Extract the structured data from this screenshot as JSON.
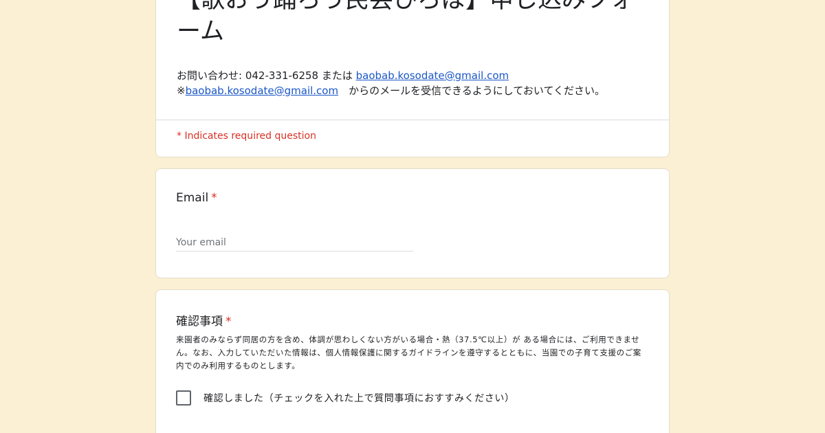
{
  "header": {
    "title": "【歌おう踊ろう民芸ひろば】申し込みフォーム",
    "contact_prefix": "お問い合わせ: 042-331-6258 または ",
    "contact_email": "baobab.kosodate@gmail.com",
    "notice_prefix": "※",
    "notice_email": "baobab.kosodate@gmail.com",
    "notice_suffix": "　からのメールを受信できるようにしておいてください。",
    "required_note": "* Indicates required question"
  },
  "email_question": {
    "label": "Email",
    "required_mark": "*",
    "placeholder": "Your email"
  },
  "confirm_question": {
    "label": "確認事項",
    "required_mark": "*",
    "description": "来園者のみならず同居の方を含め、体調が思わしくない方がいる場合・熱（37.5℃以上）が ある場合には、ご利用できません。なお、入力していただいた情報は、個人情報保護に関するガイドラインを遵守するとともに、当園での子育て支援のご案内でのみ利用するものとします。",
    "checkbox_label": "確認しました（チェックを入れた上で質問事項におすすみください）"
  },
  "colors": {
    "background": "#fbf0d3",
    "required": "#d93025",
    "link": "#1a56c6"
  }
}
